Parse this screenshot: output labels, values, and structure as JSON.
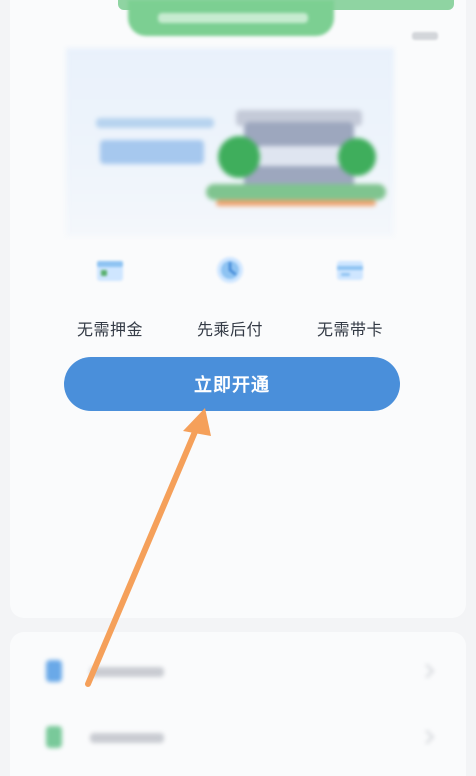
{
  "features": [
    {
      "icon": "wallet-icon",
      "label": "无需押金"
    },
    {
      "icon": "clock-icon",
      "label": "先乘后付"
    },
    {
      "icon": "card-icon",
      "label": "无需带卡"
    }
  ],
  "primary_button": {
    "label": "立即开通"
  },
  "colors": {
    "accent_green": "#7ccf92",
    "button_blue": "#4a8fda",
    "arrow_orange": "#f5a05a",
    "feature_icon_bg": "#d9ecff"
  },
  "list_items": [
    {
      "icon": "bus-card-icon"
    },
    {
      "icon": "document-icon"
    }
  ]
}
